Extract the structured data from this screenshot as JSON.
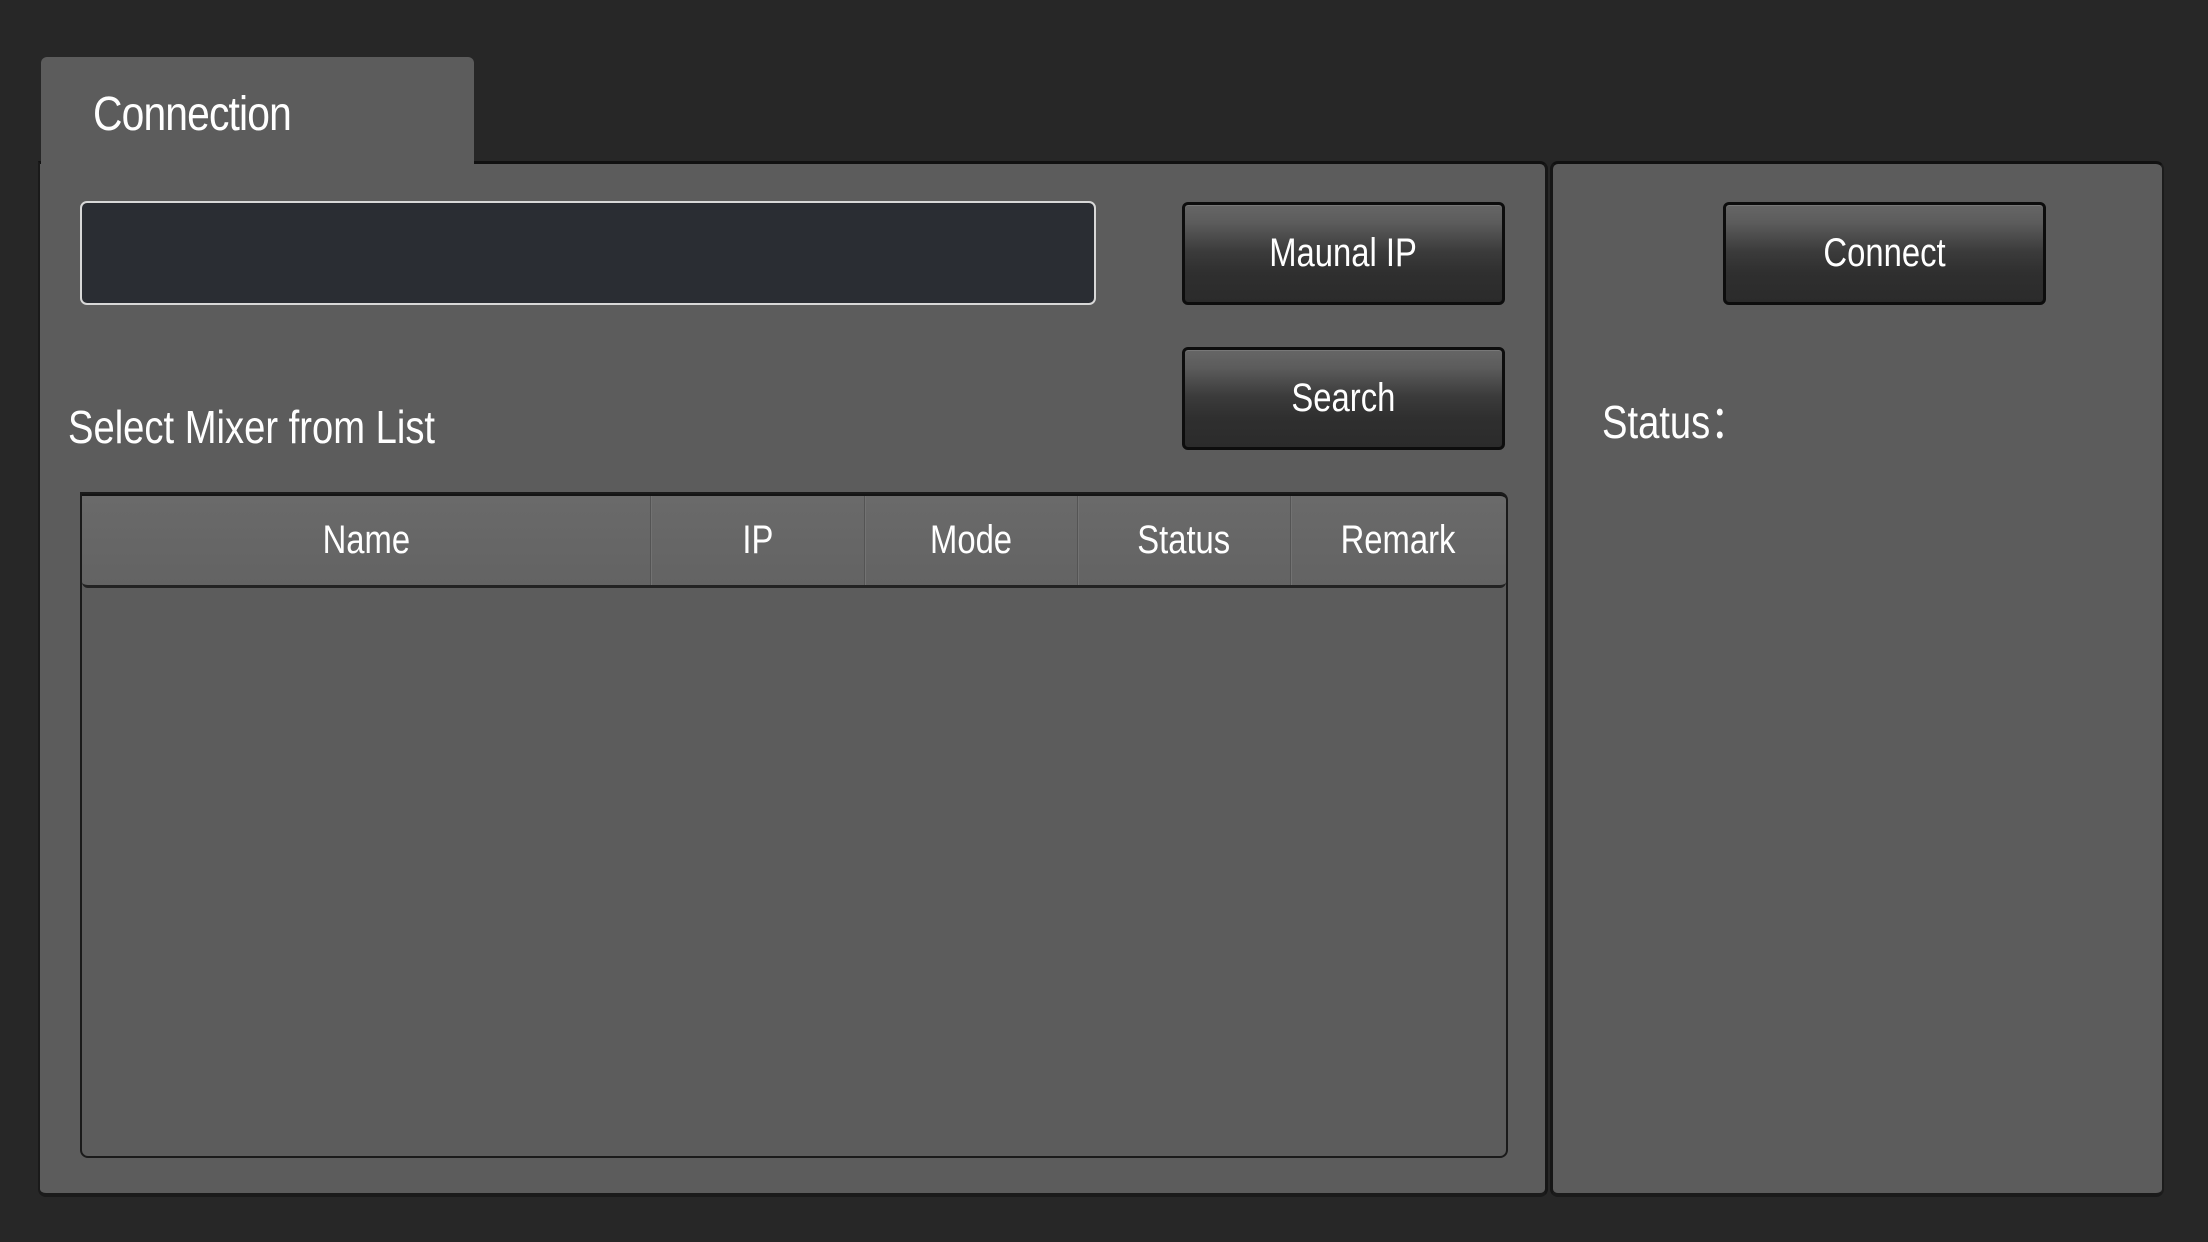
{
  "tab": {
    "label": "Connection"
  },
  "ip_input": {
    "value": "",
    "placeholder": ""
  },
  "buttons": {
    "manual_ip": "Maunal IP",
    "search": "Search",
    "connect": "Connect"
  },
  "mixer_list": {
    "title": "Select Mixer from List",
    "columns": [
      "Name",
      "IP",
      "Mode",
      "Status",
      "Remark"
    ],
    "rows": []
  },
  "status": {
    "label": "Status：",
    "value": ""
  }
}
